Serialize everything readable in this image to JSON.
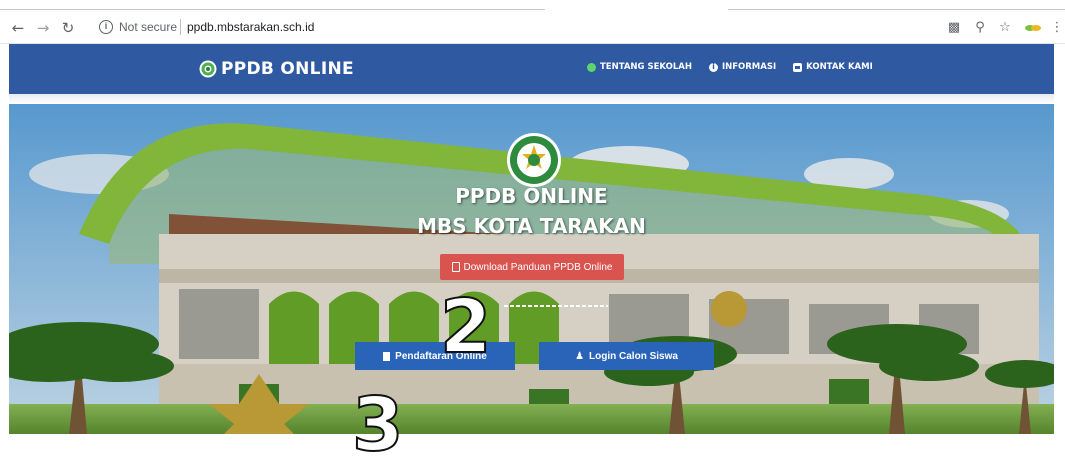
{
  "browser": {
    "security_label": "Not secure",
    "url": "ppdb.mbstarakan.sch.id",
    "icons": [
      "back-icon",
      "forward-icon",
      "reload-icon",
      "info-icon",
      "translate-icon",
      "zoom-icon",
      "star-icon",
      "extension-icon",
      "menu-icon"
    ]
  },
  "navbar": {
    "brand": "PPDB ONLINE",
    "menu": [
      {
        "label": "TENTANG SEKOLAH",
        "icon": "circle-check-icon"
      },
      {
        "label": "INFORMASI",
        "icon": "info-circle-icon"
      },
      {
        "label": "KONTAK KAMI",
        "icon": "contact-card-icon"
      }
    ],
    "color": "#2f5aa1"
  },
  "hero": {
    "title_line1": "PPDB ONLINE",
    "title_line2": "MBS KOTA TARAKAN",
    "download_button": "Download Panduan PPDB Online",
    "register_button": "Pendaftaran Online",
    "login_button": "Login Calon Siswa",
    "download_color": "#d9534f",
    "cta_color": "#2a64b8"
  },
  "annotations": [
    "2",
    "3"
  ]
}
